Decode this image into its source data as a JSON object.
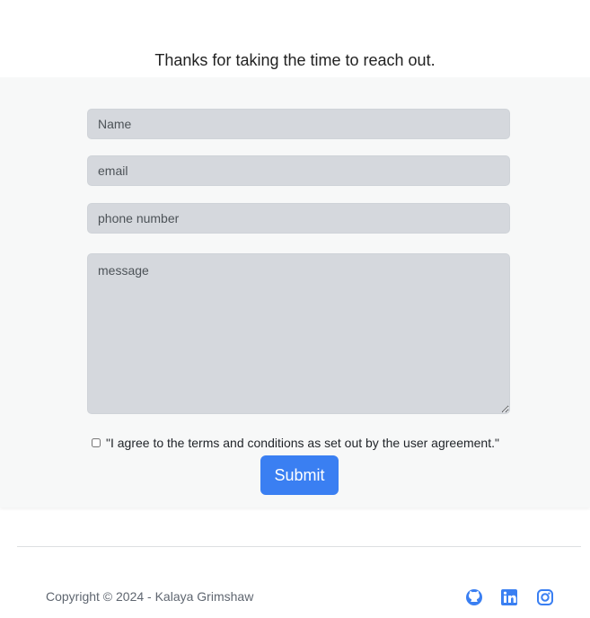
{
  "contact": {
    "heading": "Thanks for taking the time to reach out.",
    "name_placeholder": "Name",
    "email_placeholder": "email",
    "phone_placeholder": "phone number",
    "message_placeholder": "message",
    "agreement_text": "\"I agree to the terms and conditions as set out by the user agreement.\"",
    "submit_label": "Submit"
  },
  "footer": {
    "copyright": "Copyright © 2024 - Kalaya Grimshaw",
    "social_icons": [
      "github-icon",
      "linkedin-icon",
      "instagram-icon"
    ]
  },
  "colors": {
    "accent": "#3a7ff2",
    "form_background": "#f7f8f8",
    "field_background": "#d5d8dd"
  }
}
